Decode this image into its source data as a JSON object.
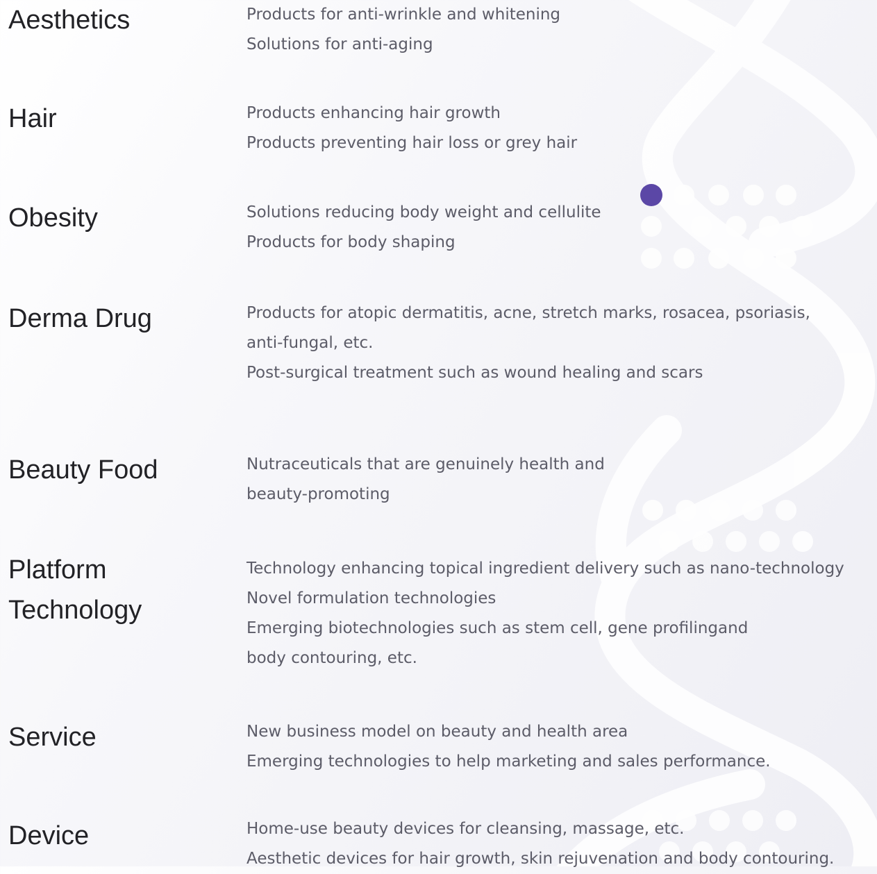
{
  "colors": {
    "accent_dot": "#5b47a6",
    "category_text": "#222226",
    "description_text": "#5c5c68"
  },
  "rows": [
    {
      "category": "Aesthetics",
      "lines": [
        "Products for anti-wrinkle and whitening",
        "Solutions for anti-aging"
      ]
    },
    {
      "category": "Hair",
      "lines": [
        "Products enhancing hair growth",
        "Products preventing hair loss or grey hair"
      ]
    },
    {
      "category": "Obesity",
      "lines": [
        "Solutions reducing body weight and cellulite",
        "Products for body shaping"
      ]
    },
    {
      "category": "Derma Drug",
      "lines": [
        "Products for atopic dermatitis, acne, stretch marks, rosacea, psoriasis,",
        "anti-fungal, etc.",
        "Post-surgical treatment such as wound healing and scars"
      ]
    },
    {
      "category": "Beauty Food",
      "lines": [
        "Nutraceuticals that are genuinely health and",
        "beauty-promoting"
      ]
    },
    {
      "category": "Platform Technology",
      "category_lines": [
        "Platform",
        "Technology"
      ],
      "lines": [
        "Technology enhancing topical ingredient delivery such as nano-technology",
        "Novel formulation technologies",
        "Emerging biotechnologies such as stem cell, gene profilingand",
        "body contouring, etc."
      ]
    },
    {
      "category": "Service",
      "lines": [
        "New business model on beauty and health area",
        "Emerging technologies to help marketing and sales performance."
      ]
    },
    {
      "category": "Device",
      "lines": [
        "Home-use beauty devices for cleansing, massage, etc.",
        "Aesthetic devices for hair growth, skin rejuvenation and body contouring."
      ]
    }
  ]
}
